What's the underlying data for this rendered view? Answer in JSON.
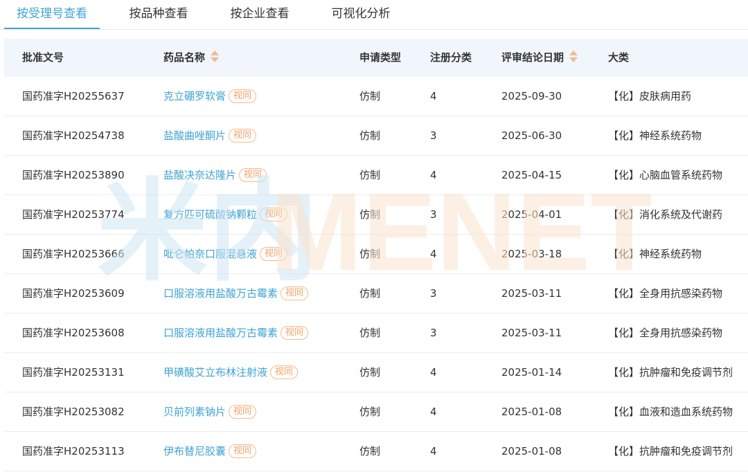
{
  "tabs": [
    {
      "label": "按受理号查看"
    },
    {
      "label": "按品种查看"
    },
    {
      "label": "按企业查看"
    },
    {
      "label": "可视化分析"
    }
  ],
  "active_tab": 0,
  "table": {
    "headers": [
      "批准文号",
      "药品名称",
      "申请类型",
      "注册分类",
      "评审结论日期",
      "大类"
    ],
    "badge_label": "视同",
    "rows": [
      {
        "approval_no": "国药准字H20255637",
        "drug": "克立硼罗软膏",
        "app_type": "仿制",
        "reg_class": "4",
        "date": "2025-09-30",
        "category": "【化】皮肤病用药"
      },
      {
        "approval_no": "国药准字H20254738",
        "drug": "盐酸曲唑酮片",
        "app_type": "仿制",
        "reg_class": "3",
        "date": "2025-06-30",
        "category": "【化】神经系统药物"
      },
      {
        "approval_no": "国药准字H20253890",
        "drug": "盐酸决奈达隆片",
        "app_type": "仿制",
        "reg_class": "4",
        "date": "2025-04-15",
        "category": "【化】心脑血管系统药物"
      },
      {
        "approval_no": "国药准字H20253774",
        "drug": "复方匹可硫酸钠颗粒",
        "app_type": "仿制",
        "reg_class": "3",
        "date": "2025-04-01",
        "category": "【化】消化系统及代谢药"
      },
      {
        "approval_no": "国药准字H20253666",
        "drug": "吡仑帕奈口服混悬液",
        "app_type": "仿制",
        "reg_class": "4",
        "date": "2025-03-18",
        "category": "【化】神经系统药物"
      },
      {
        "approval_no": "国药准字H20253609",
        "drug": "口服溶液用盐酸万古霉素",
        "app_type": "仿制",
        "reg_class": "3",
        "date": "2025-03-11",
        "category": "【化】全身用抗感染药物"
      },
      {
        "approval_no": "国药准字H20253608",
        "drug": "口服溶液用盐酸万古霉素",
        "app_type": "仿制",
        "reg_class": "3",
        "date": "2025-03-11",
        "category": "【化】全身用抗感染药物"
      },
      {
        "approval_no": "国药准字H20253131",
        "drug": "甲磺酸艾立布林注射液",
        "app_type": "仿制",
        "reg_class": "4",
        "date": "2025-01-14",
        "category": "【化】抗肿瘤和免疫调节剂"
      },
      {
        "approval_no": "国药准字H20253082",
        "drug": "贝前列素钠片",
        "app_type": "仿制",
        "reg_class": "4",
        "date": "2025-01-08",
        "category": "【化】血液和造血系统药物"
      },
      {
        "approval_no": "国药准字H20253113",
        "drug": "伊布替尼胶囊",
        "app_type": "仿制",
        "reg_class": "4",
        "date": "2025-01-08",
        "category": "【化】抗肿瘤和免疫调节剂"
      }
    ]
  },
  "watermark": {
    "text": "米内MENET",
    "colors": {
      "blue": "#cfe6f3",
      "orange": "#fbe3cf"
    }
  },
  "colors": {
    "accent": "#3ea3d3",
    "badge": "#f0a060",
    "header_bg": "#f0f6fb"
  }
}
